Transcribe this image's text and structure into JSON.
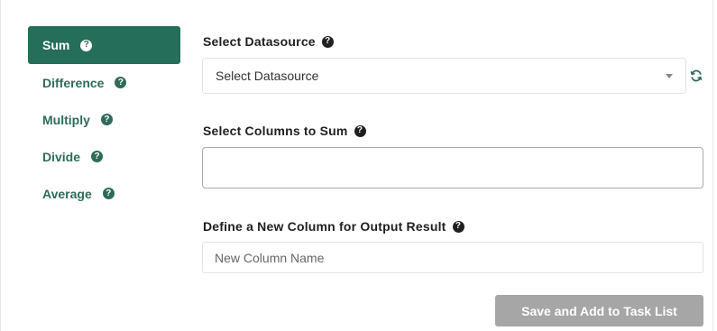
{
  "sidebar": {
    "items": [
      {
        "label": "Sum",
        "active": true
      },
      {
        "label": "Difference",
        "active": false
      },
      {
        "label": "Multiply",
        "active": false
      },
      {
        "label": "Divide",
        "active": false
      },
      {
        "label": "Average",
        "active": false
      }
    ],
    "help_icon": "question-circle-icon"
  },
  "datasource": {
    "label": "Select Datasource",
    "selected": "Select Datasource",
    "refresh_icon": "refresh-icon"
  },
  "columns": {
    "label": "Select Columns to Sum"
  },
  "output": {
    "label": "Define a New Column for Output Result",
    "placeholder": "New Column Name"
  },
  "actions": {
    "save_label": "Save and Add to Task List"
  },
  "colors": {
    "accent": "#256e5a",
    "nav_text": "#2e6b5b",
    "button_disabled": "#a6a6a6"
  }
}
